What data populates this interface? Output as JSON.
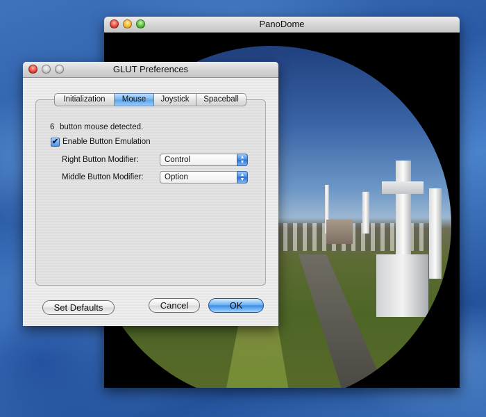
{
  "pano_window": {
    "title": "PanoDome"
  },
  "prefs_dialog": {
    "title": "GLUT Preferences",
    "tabs": [
      {
        "label": "Initialization",
        "active": false
      },
      {
        "label": "Mouse",
        "active": true
      },
      {
        "label": "Joystick",
        "active": false
      },
      {
        "label": "Spaceball",
        "active": false
      }
    ],
    "mouse": {
      "detected_count": "6",
      "detected_text": "button mouse detected.",
      "emulation_label": "Enable Button Emulation",
      "emulation_checked": true,
      "check_glyph": "✔",
      "right_modifier_label": "Right Button Modifier:",
      "right_modifier_value": "Control",
      "middle_modifier_label": "Middle Button Modifier:",
      "middle_modifier_value": "Option"
    },
    "buttons": {
      "set_defaults": "Set Defaults",
      "cancel": "Cancel",
      "ok": "OK"
    }
  },
  "icons": {
    "close": "close-icon",
    "minimize": "minimize-icon",
    "zoom": "zoom-icon",
    "select_arrows": "updown-arrows-icon"
  },
  "colors": {
    "desktop": "#2a5aa6",
    "accent": "#3d8ce6",
    "close": "#e0443a",
    "minimize": "#f2b52c",
    "zoom": "#54b93a"
  }
}
